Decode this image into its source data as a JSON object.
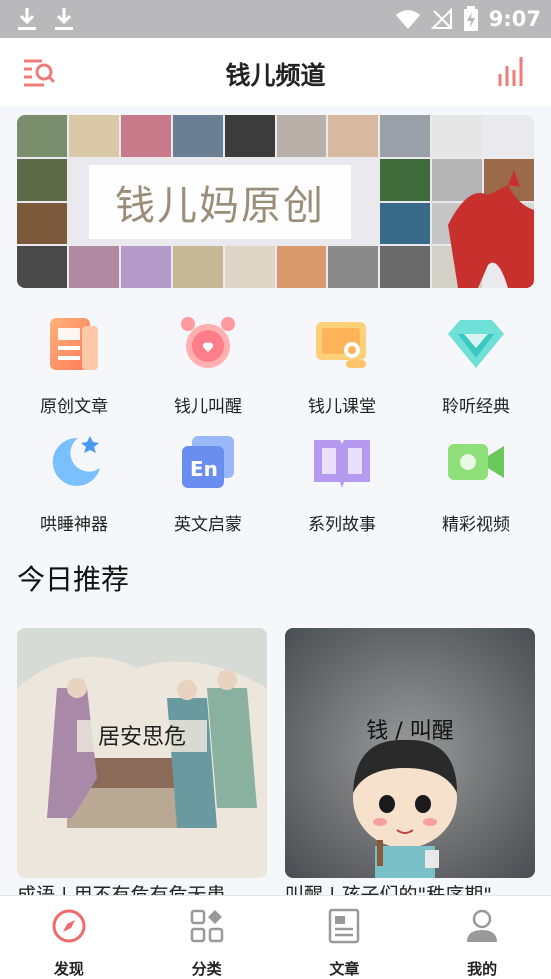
{
  "status": {
    "time": "9:07"
  },
  "header": {
    "title": "钱儿频道"
  },
  "banner": {
    "text": "钱儿妈原创"
  },
  "categories": [
    {
      "label": "原创文章",
      "icon": "article-icon"
    },
    {
      "label": "钱儿叫醒",
      "icon": "alarm-clock-icon"
    },
    {
      "label": "钱儿课堂",
      "icon": "classroom-icon"
    },
    {
      "label": "聆听经典",
      "icon": "diamond-icon"
    },
    {
      "label": "哄睡神器",
      "icon": "moon-icon"
    },
    {
      "label": "英文启蒙",
      "icon": "english-icon"
    },
    {
      "label": "系列故事",
      "icon": "book-icon"
    },
    {
      "label": "精彩视频",
      "icon": "video-icon"
    }
  ],
  "recommend": {
    "title": "今日推荐",
    "cards": [
      {
        "image_text": "居安思危",
        "caption": "成语 | 用不有危有危无患"
      },
      {
        "image_text": "钱 / 叫醒",
        "caption": "叫醒 | 孩子们的\"秩序期\""
      }
    ]
  },
  "tabs": [
    {
      "label": "发现",
      "icon": "compass-icon"
    },
    {
      "label": "分类",
      "icon": "grid-icon"
    },
    {
      "label": "文章",
      "icon": "document-icon"
    },
    {
      "label": "我的",
      "icon": "user-icon"
    }
  ]
}
